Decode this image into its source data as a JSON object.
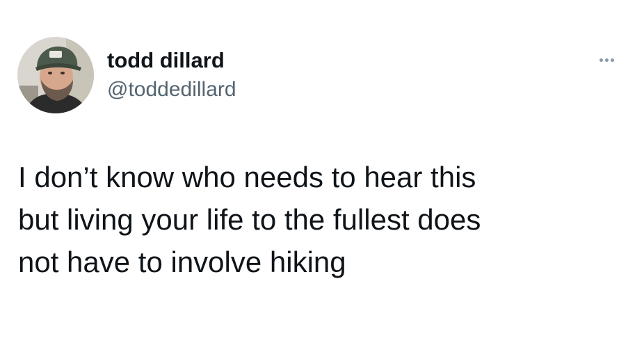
{
  "tweet": {
    "author": {
      "display_name": "todd dillard",
      "handle": "@toddedillard",
      "avatar_icon": "profile-photo"
    },
    "more_icon": "ellipsis-icon",
    "text": "I don’t know who needs to hear this\nbut living your life to the fullest does\nnot have to involve hiking"
  },
  "colors": {
    "background": "#ffffff",
    "text_primary": "#0f1419",
    "text_secondary": "#536471",
    "icon_muted": "#8b98a5"
  }
}
